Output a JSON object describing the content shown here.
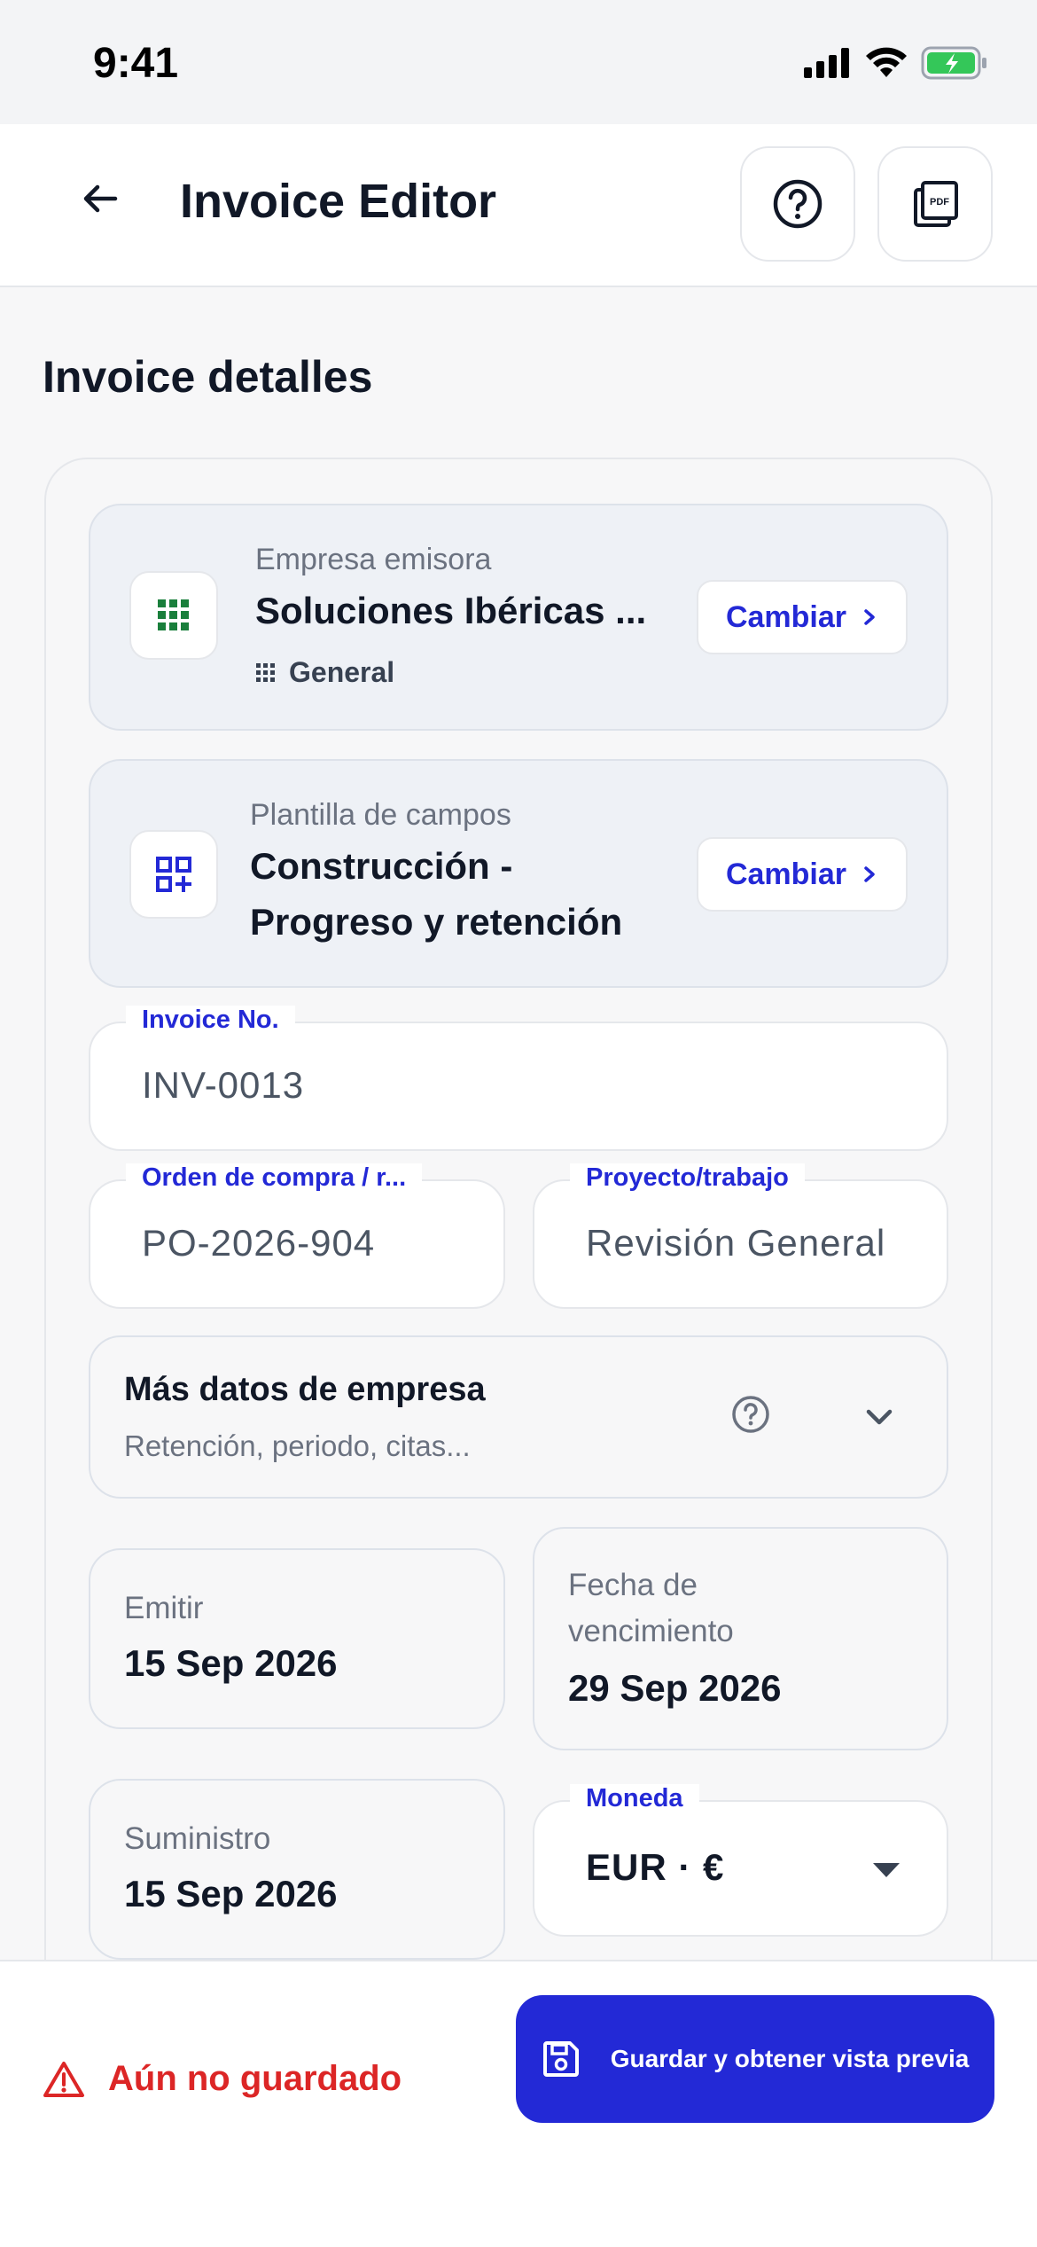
{
  "status_bar": {
    "time": "9:41"
  },
  "header": {
    "title": "Invoice Editor"
  },
  "section": {
    "title": "Invoice detalles"
  },
  "company_picker": {
    "label": "Empresa emisora",
    "value": "Soluciones Ibéricas ...",
    "sub": "General",
    "change_label": "Cambiar"
  },
  "template_picker": {
    "label": "Plantilla de campos",
    "value_line1": "Construcción -",
    "value_line2": "Progreso y retención",
    "change_label": "Cambiar"
  },
  "fields": {
    "invoice_no": {
      "label": "Invoice No.",
      "value": "INV-0013"
    },
    "po": {
      "label": "Orden de compra / r...",
      "value": "PO-2026-904"
    },
    "project": {
      "label": "Proyecto/trabajo",
      "value": "Revisión General"
    }
  },
  "more_company": {
    "title": "Más datos de empresa",
    "subtitle": "Retención, periodo, citas..."
  },
  "dates": {
    "issue": {
      "label": "Emitir",
      "value": "15 Sep 2026"
    },
    "due": {
      "label_line1": "Fecha de",
      "label_line2": "vencimiento",
      "value": "29 Sep 2026"
    },
    "supply": {
      "label": "Suministro",
      "value": "15 Sep 2026"
    }
  },
  "currency": {
    "label": "Moneda",
    "value": "EUR · €"
  },
  "footer": {
    "unsaved_text": "Aún no guardado",
    "save_button": "Guardar y obtener vista previa"
  },
  "colors": {
    "accent": "#2329d6",
    "danger": "#dc2626",
    "success": "#1a7f3c"
  }
}
